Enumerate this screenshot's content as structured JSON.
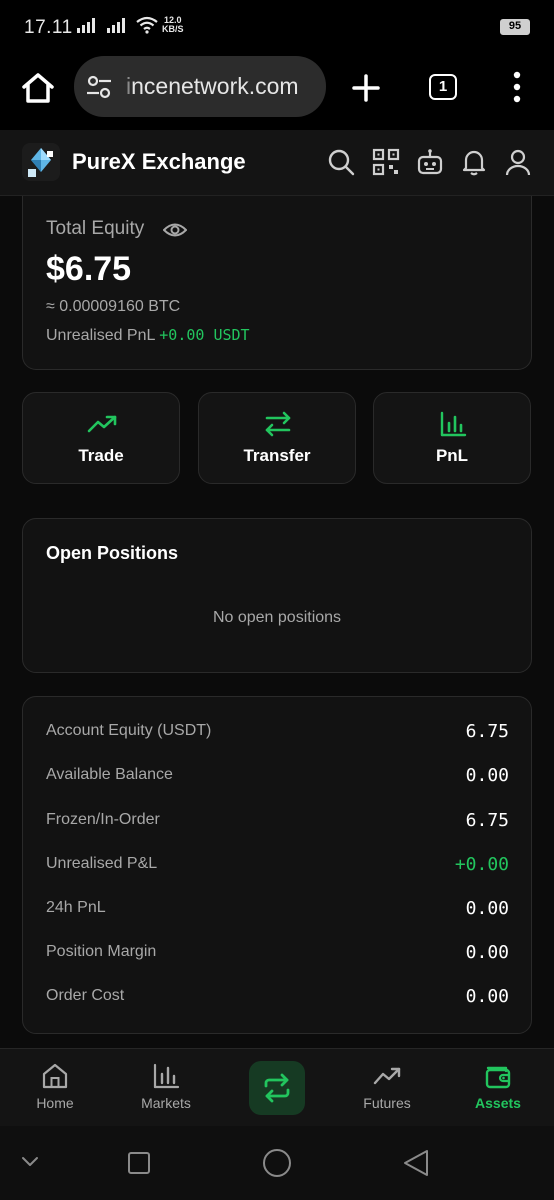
{
  "status_bar": {
    "time": "17.11",
    "net_speed_value": "12.0",
    "net_speed_unit": "KB/S",
    "battery": "95"
  },
  "browser": {
    "url_faded": "i",
    "url": "ncenetwork.com",
    "tab_count": "1"
  },
  "app": {
    "title": "PureX Exchange",
    "icons": [
      "search-icon",
      "qr-code-icon",
      "bot-icon",
      "bell-icon",
      "user-icon"
    ]
  },
  "equity": {
    "label": "Total Equity",
    "value": "$6.75",
    "btc": "≈ 0.00009160 BTC",
    "pnl_label": "Unrealised PnL",
    "pnl_value": "+0.00 USDT"
  },
  "actions": [
    {
      "label": "Trade",
      "icon": "trending-up-icon"
    },
    {
      "label": "Transfer",
      "icon": "transfer-arrows-icon"
    },
    {
      "label": "PnL",
      "icon": "bar-chart-icon"
    }
  ],
  "positions": {
    "title": "Open Positions",
    "empty_text": "No open positions"
  },
  "summary": [
    {
      "label": "Account Equity (USDT)",
      "value": "6.75"
    },
    {
      "label": "Available Balance",
      "value": "0.00"
    },
    {
      "label": "Frozen/In-Order",
      "value": "6.75"
    },
    {
      "label": "Unrealised P&L",
      "value": "+0.00"
    },
    {
      "label": "24h PnL",
      "value": "0.00"
    },
    {
      "label": "Position Margin",
      "value": "0.00"
    },
    {
      "label": "Order Cost",
      "value": "0.00"
    }
  ],
  "nav": {
    "home": "Home",
    "markets": "Markets",
    "futures": "Futures",
    "assets": "Assets",
    "active": "Assets"
  },
  "colors": {
    "accent_green": "#22c55e",
    "background": "#0b0b0b",
    "card": "#121212"
  }
}
